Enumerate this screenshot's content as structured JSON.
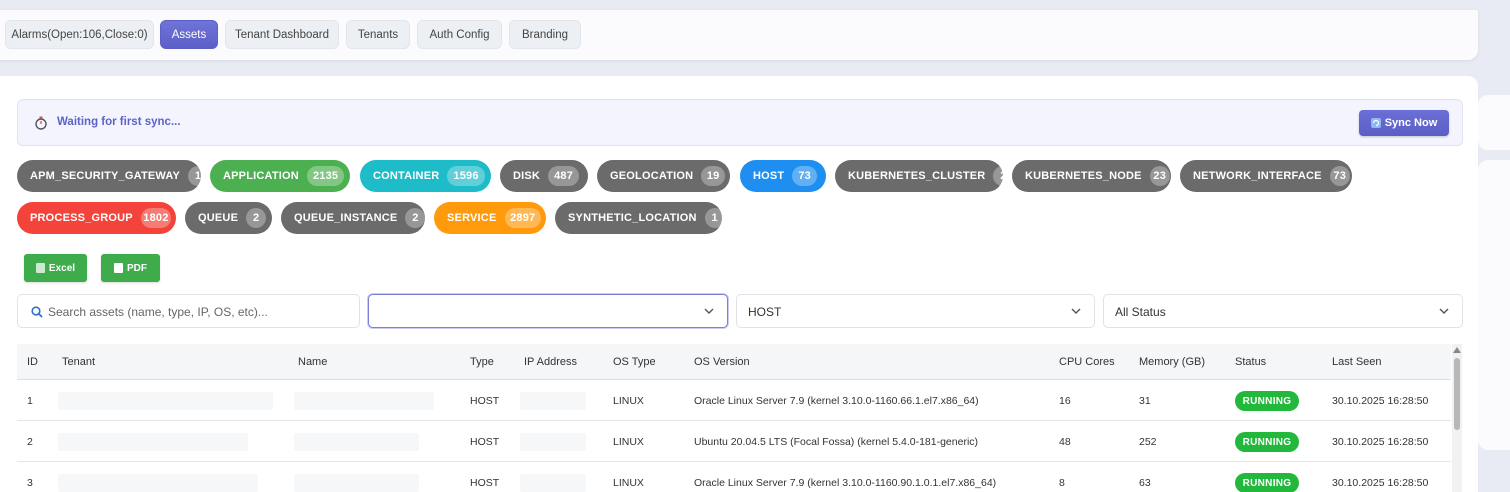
{
  "tabs": [
    {
      "label": "Alarms(Open:106,Close:0)"
    },
    {
      "label": "Assets"
    },
    {
      "label": "Tenant Dashboard"
    },
    {
      "label": "Tenants"
    },
    {
      "label": "Auth Config"
    },
    {
      "label": "Branding"
    }
  ],
  "active_tab": "Assets",
  "sync": {
    "status_text": "Waiting for first sync...",
    "button_label": "Sync Now"
  },
  "asset_types": [
    {
      "name": "APM_SECURITY_GATEWAY",
      "count": "1",
      "color": "#6b6b6b"
    },
    {
      "name": "APPLICATION",
      "count": "2135",
      "color": "#4caf50"
    },
    {
      "name": "CONTAINER",
      "count": "1596",
      "color": "#1ebbc9"
    },
    {
      "name": "DISK",
      "count": "487",
      "color": "#6b6b6b"
    },
    {
      "name": "GEOLOCATION",
      "count": "19",
      "color": "#6b6b6b"
    },
    {
      "name": "HOST",
      "count": "73",
      "color": "#1e8ff0"
    },
    {
      "name": "KUBERNETES_CLUSTER",
      "count": "2",
      "color": "#6b6b6b"
    },
    {
      "name": "KUBERNETES_NODE",
      "count": "23",
      "color": "#6b6b6b"
    },
    {
      "name": "NETWORK_INTERFACE",
      "count": "73",
      "color": "#6b6b6b"
    },
    {
      "name": "PROCESS_GROUP",
      "count": "1802",
      "color": "#f4433a"
    },
    {
      "name": "QUEUE",
      "count": "2",
      "color": "#6b6b6b"
    },
    {
      "name": "QUEUE_INSTANCE",
      "count": "2",
      "color": "#6b6b6b"
    },
    {
      "name": "SERVICE",
      "count": "2897",
      "color": "#ff9a0d"
    },
    {
      "name": "SYNTHETIC_LOCATION",
      "count": "1",
      "color": "#6b6b6b"
    }
  ],
  "export": {
    "excel_label": "Excel",
    "pdf_label": "PDF"
  },
  "filters": {
    "search_placeholder": "Search assets (name, type, IP, OS, etc)...",
    "tenant_value": "",
    "type_value": "HOST",
    "status_value": "All Status"
  },
  "table": {
    "columns": [
      "ID",
      "Tenant",
      "Name",
      "Type",
      "IP Address",
      "OS Type",
      "OS Version",
      "CPU Cores",
      "Memory (GB)",
      "Status",
      "Last Seen"
    ],
    "rows": [
      {
        "id": "1",
        "tenant": "",
        "name": "",
        "type": "HOST",
        "ip": "",
        "os_type": "LINUX",
        "os_version": "Oracle Linux Server 7.9 (kernel 3.10.0-1160.66.1.el7.x86_64)",
        "cpu": "16",
        "memory": "31",
        "status": "RUNNING",
        "last_seen": "30.10.2025 16:28:50"
      },
      {
        "id": "2",
        "tenant": "",
        "name": "",
        "type": "HOST",
        "ip": "",
        "os_type": "LINUX",
        "os_version": "Ubuntu 20.04.5 LTS (Focal Fossa) (kernel 5.4.0-181-generic)",
        "cpu": "48",
        "memory": "252",
        "status": "RUNNING",
        "last_seen": "30.10.2025 16:28:50"
      },
      {
        "id": "3",
        "tenant": "",
        "name": "",
        "type": "HOST",
        "ip": "",
        "os_type": "LINUX",
        "os_version": "Oracle Linux Server 7.9 (kernel 3.10.0-1160.90.1.0.1.el7.x86_64)",
        "cpu": "8",
        "memory": "63",
        "status": "RUNNING",
        "last_seen": "30.10.2025 16:28:50"
      }
    ]
  },
  "colors": {
    "accent": "#5b5fc7",
    "success": "#22b83b",
    "export": "#3fac4c"
  }
}
